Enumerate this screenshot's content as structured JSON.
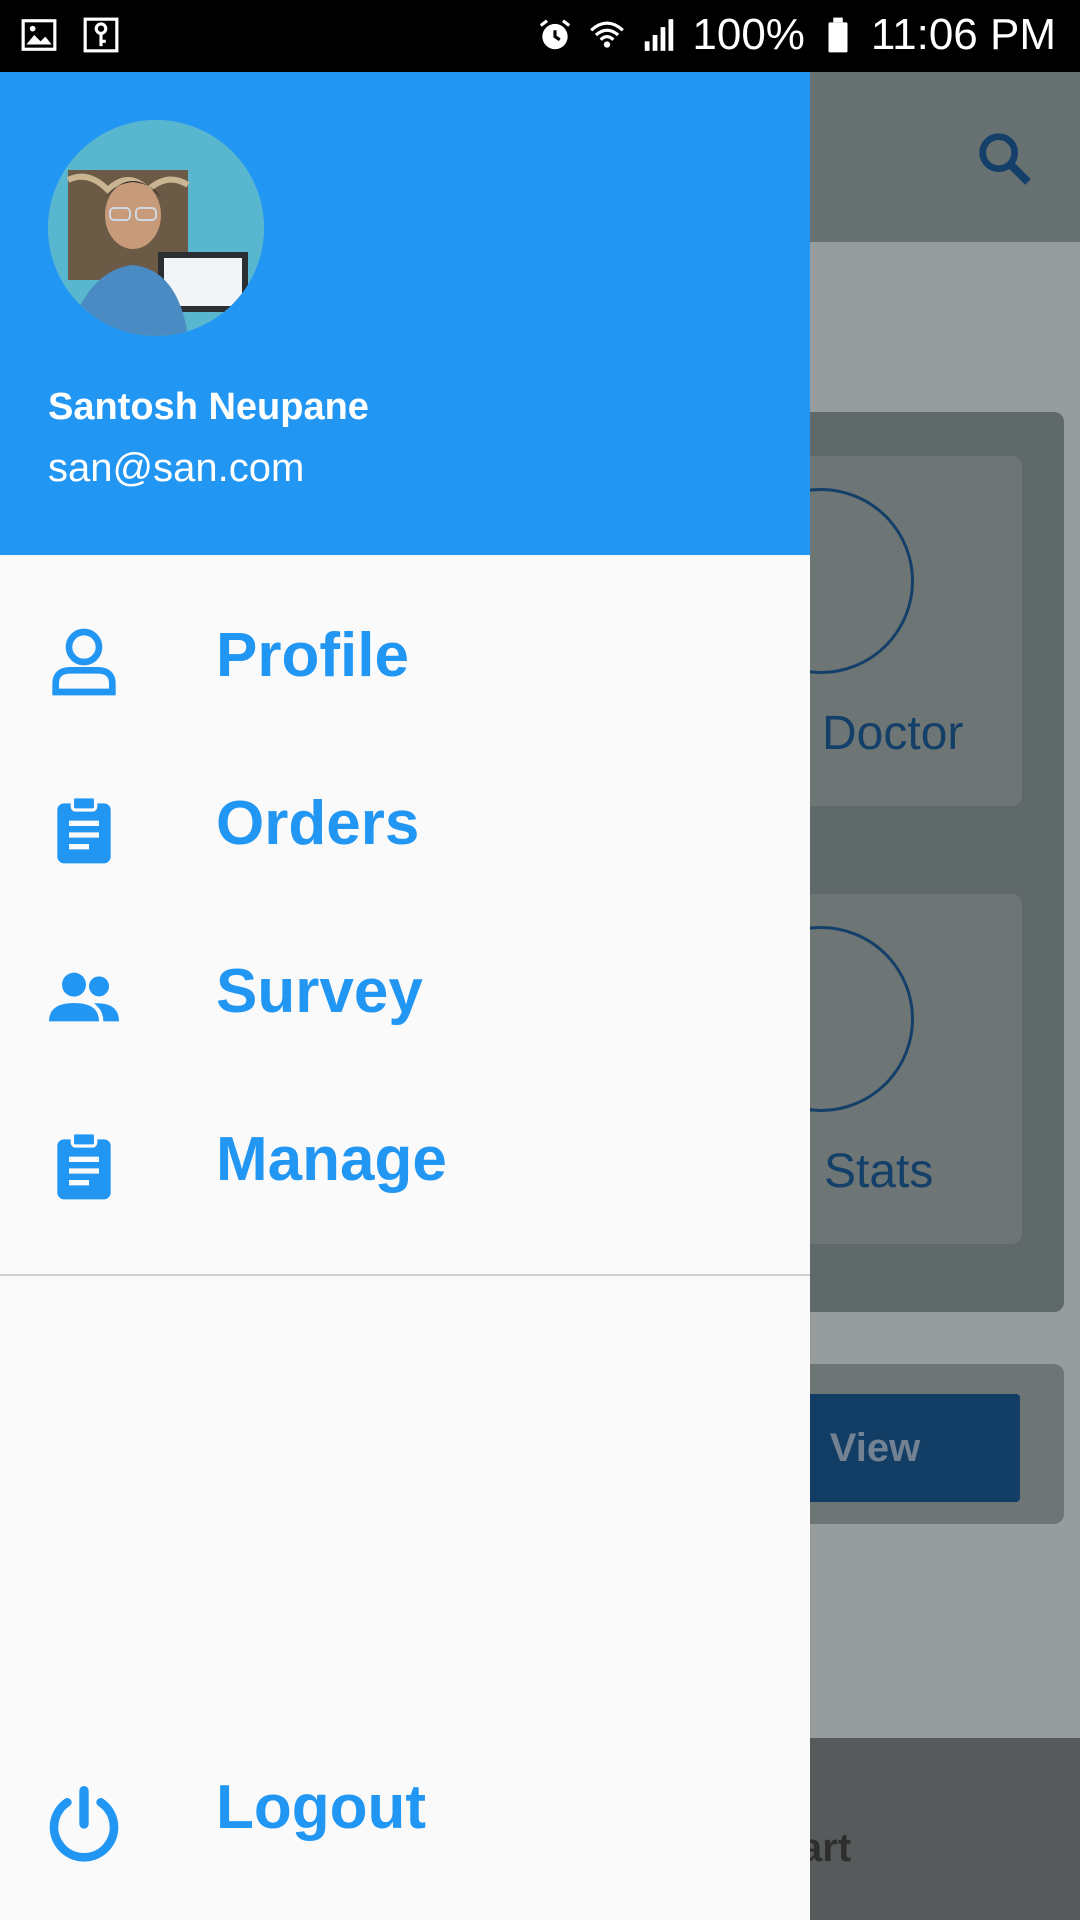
{
  "status_bar": {
    "battery": "100%",
    "time": "11:06 PM",
    "icons": [
      "gallery-icon",
      "key-icon",
      "alarm-icon",
      "wifi-icon",
      "signal-icon",
      "battery-icon"
    ]
  },
  "background": {
    "cards": [
      {
        "label": "Doctor",
        "icon": "person-icon"
      },
      {
        "label": "Stats",
        "icon": "calculator-icon"
      }
    ],
    "view_button": "View",
    "bottom_nav_partial_label": "art"
  },
  "drawer": {
    "header_color": "#2196f3",
    "user": {
      "name": "Santosh Neupane",
      "email": "san@san.com"
    },
    "menu": [
      {
        "label": "Profile",
        "icon": "person-outline-icon"
      },
      {
        "label": "Orders",
        "icon": "clipboard-icon"
      },
      {
        "label": "Survey",
        "icon": "people-icon"
      },
      {
        "label": "Manage",
        "icon": "clipboard-icon"
      }
    ],
    "logout": {
      "label": "Logout",
      "icon": "power-icon"
    }
  }
}
